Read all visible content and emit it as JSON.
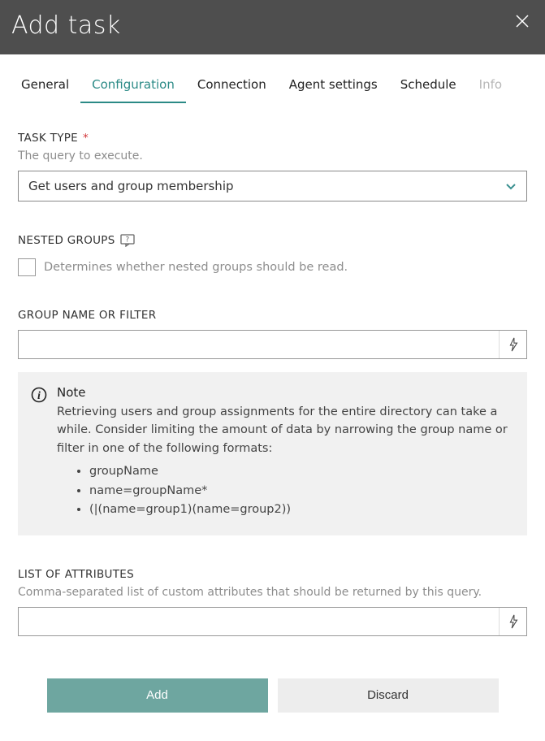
{
  "header": {
    "title": "Add task"
  },
  "tabs": [
    {
      "label": "General",
      "active": false
    },
    {
      "label": "Configuration",
      "active": true
    },
    {
      "label": "Connection",
      "active": false
    },
    {
      "label": "Agent settings",
      "active": false
    },
    {
      "label": "Schedule",
      "active": false
    },
    {
      "label": "Info",
      "active": false,
      "disabled": true
    }
  ],
  "task_type": {
    "label": "TASK TYPE",
    "required_mark": "*",
    "description": "The query to execute.",
    "value": "Get users and group membership"
  },
  "nested_groups": {
    "label": "NESTED GROUPS",
    "description": "Determines whether nested groups should be read.",
    "checked": false
  },
  "group_filter": {
    "label": "GROUP NAME OR FILTER",
    "value": ""
  },
  "note": {
    "title": "Note",
    "body": "Retrieving users and group assignments for the entire directory can take a while. Consider limiting the amount of data by narrowing the group name or filter in one of the following formats:",
    "items": [
      "groupName",
      "name=groupName*",
      "(|(name=group1)(name=group2))"
    ]
  },
  "attributes": {
    "label": "LIST OF ATTRIBUTES",
    "description": "Comma-separated list of custom attributes that should be returned by this query.",
    "value": ""
  },
  "footer": {
    "primary": "Add",
    "secondary": "Discard"
  }
}
